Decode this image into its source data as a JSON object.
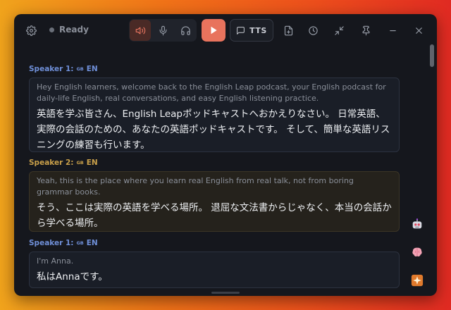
{
  "toolbar": {
    "status_text": "Ready",
    "tts_label": "TTS",
    "icons": [
      "gear-icon",
      "speaker-icon",
      "microphone-icon",
      "headphones-icon",
      "play-icon",
      "message-icon",
      "file-plus-icon",
      "clock-icon",
      "collapse-icon",
      "pin-icon",
      "minimize-icon",
      "close-icon"
    ]
  },
  "colors": {
    "accent": "#e8735d",
    "speaker1": "#6f8fd8",
    "speaker2": "#c9a04a",
    "background": "#15171d"
  },
  "transcript": [
    {
      "speaker": "Speaker 1:",
      "flag": "GB",
      "lang": "EN",
      "english": "Hey English learners, welcome back to the English Leap podcast, your English podcast for daily-life English, real conversations, and easy English listening practice.",
      "japanese": "英語を学ぶ皆さん、English Leapポッドキャストへおかえりなさい。 日常英語、実際の会話のための、あなたの英語ポッドキャストです。 そして、簡単な英語リスニングの練習も行います。"
    },
    {
      "speaker": "Speaker 2:",
      "flag": "GB",
      "lang": "EN",
      "english": "Yeah, this is the place where you learn real English from real talk, not from boring grammar books.",
      "japanese": "そう、ここは実際の英語を学べる場所。 退屈な文法書からじゃなく、本当の会話から学べる場所。"
    },
    {
      "speaker": "Speaker 1:",
      "flag": "GB",
      "lang": "EN",
      "english": "I'm Anna.",
      "japanese": "私はAnnaです。"
    }
  ],
  "side_icons": [
    "robot-icon",
    "brain-icon",
    "sparkle-icon"
  ]
}
